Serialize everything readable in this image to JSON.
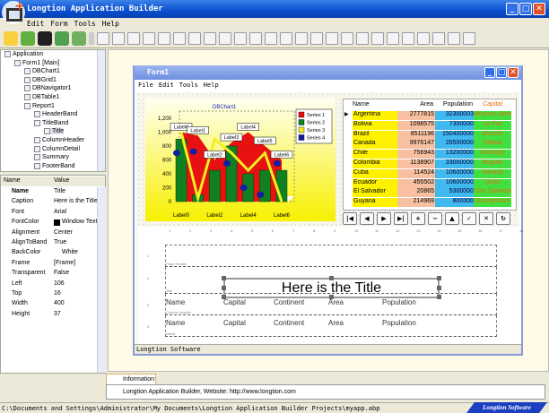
{
  "app": {
    "title": "Longtion Application Builder",
    "menu": [
      "Edit",
      "Form",
      "Tools",
      "Help"
    ]
  },
  "tree": [
    {
      "label": "Application",
      "level": 0
    },
    {
      "label": "Form1 [Main]",
      "level": 1
    },
    {
      "label": "DBChart1",
      "level": 2
    },
    {
      "label": "DBGrid1",
      "level": 2
    },
    {
      "label": "DBNavigator1",
      "level": 2
    },
    {
      "label": "DBTable1",
      "level": 2
    },
    {
      "label": "Report1",
      "level": 2
    },
    {
      "label": "HeaderBand",
      "level": 3
    },
    {
      "label": "TitleBand",
      "level": 3
    },
    {
      "label": "Title",
      "level": 4
    },
    {
      "label": "ColumnHeader",
      "level": 3
    },
    {
      "label": "ColumnDetail",
      "level": 3
    },
    {
      "label": "Summary",
      "level": 3
    },
    {
      "label": "FooterBand",
      "level": 3
    }
  ],
  "props": {
    "headers": [
      "Name",
      "Value"
    ],
    "rows": [
      [
        "Name",
        "Title"
      ],
      [
        "Caption",
        "Here is the Title"
      ],
      [
        "Font",
        "Arial"
      ],
      [
        "FontColor",
        "Window Text"
      ],
      [
        "Alignment",
        "Center"
      ],
      [
        "AlignToBand",
        "True"
      ],
      [
        "BackColor",
        "White"
      ],
      [
        "Frame",
        "[Frame]"
      ],
      [
        "Transparent",
        "False"
      ],
      [
        "Left",
        "106"
      ],
      [
        "Top",
        "16"
      ],
      [
        "Width",
        "400"
      ],
      [
        "Height",
        "37"
      ]
    ]
  },
  "form": {
    "title": "Form1",
    "menu": [
      "File",
      "Edit",
      "Tools",
      "Help"
    ],
    "status": "Longtion Software"
  },
  "chart": {
    "title": "DBChart1",
    "categories": [
      "Label0",
      "Label1",
      "Label2",
      "Label3",
      "Label4",
      "Label5",
      "Label6"
    ],
    "xticks": [
      "Label0",
      "Label2",
      "Label4",
      "Label6"
    ],
    "yticks": [
      "0",
      "200",
      "400",
      "600",
      "800",
      "1,000",
      "1,200"
    ],
    "ylim": [
      0,
      1200
    ],
    "series": [
      {
        "name": "Series 1",
        "color": "#e81010",
        "values": [
          1000,
          950,
          600,
          850,
          1000,
          800,
          600
        ]
      },
      {
        "name": "Series 2",
        "color": "#108020",
        "values": [
          900,
          100,
          450,
          800,
          400,
          450,
          450
        ]
      },
      {
        "name": "Series 3",
        "color": "#f0f020",
        "values": [
          1000,
          50,
          900,
          700,
          450,
          700,
          0
        ]
      },
      {
        "name": "Series 4",
        "color": "#1020a0",
        "values": [
          700,
          720,
          680,
          550,
          200,
          100,
          550
        ]
      }
    ]
  },
  "grid": {
    "headers": [
      "Name",
      "Area",
      "Population",
      "Capital"
    ],
    "rows": [
      [
        "Argentina",
        "2777815",
        "32300003",
        "Buenos Aires"
      ],
      [
        "Bolivia",
        "1098575",
        "7300000",
        "La Paz"
      ],
      [
        "Brazil",
        "8511196",
        "150400000",
        "Brasilia"
      ],
      [
        "Canada",
        "9976147",
        "26500000",
        "Ottawa"
      ],
      [
        "Chile",
        "756943",
        "13200000",
        "Santiago"
      ],
      [
        "Colombia",
        "1138907",
        "33000000",
        "Bogota"
      ],
      [
        "Cuba",
        "114524",
        "10600000",
        "Havana"
      ],
      [
        "Ecuador",
        "455502",
        "10600000",
        "Quito"
      ],
      [
        "El Salvador",
        "20865",
        "5300000",
        "San Salvador"
      ],
      [
        "Guyana",
        "214969",
        "800000",
        "Georgetown"
      ]
    ]
  },
  "navigator": [
    "|◀",
    "◀",
    "▶",
    "▶|",
    "+",
    "−",
    "▲",
    "✓",
    "✕",
    "↻"
  ],
  "report": {
    "ruler": [
      "1",
      "2",
      "3",
      "4",
      "5",
      "6",
      "7",
      "8",
      "9",
      "10",
      "11",
      "12",
      "13",
      "14",
      "15",
      "16",
      "17",
      "18"
    ],
    "bands": [
      "Page Header",
      "Title",
      "Column Header",
      "Detail"
    ],
    "title_text": "Here is the Title",
    "columns": [
      "Name",
      "Capital",
      "Continent",
      "Area",
      "Population"
    ]
  },
  "info": {
    "tab": "Information",
    "text": "Longtion Application Builder,  Website: http://www.longtion.com"
  },
  "status": {
    "path": "C:\\Documents and Settings\\Administrator\\My Documents\\Longtion Application Builder Projects\\myapp.abp",
    "brand": "Longtion Software"
  }
}
